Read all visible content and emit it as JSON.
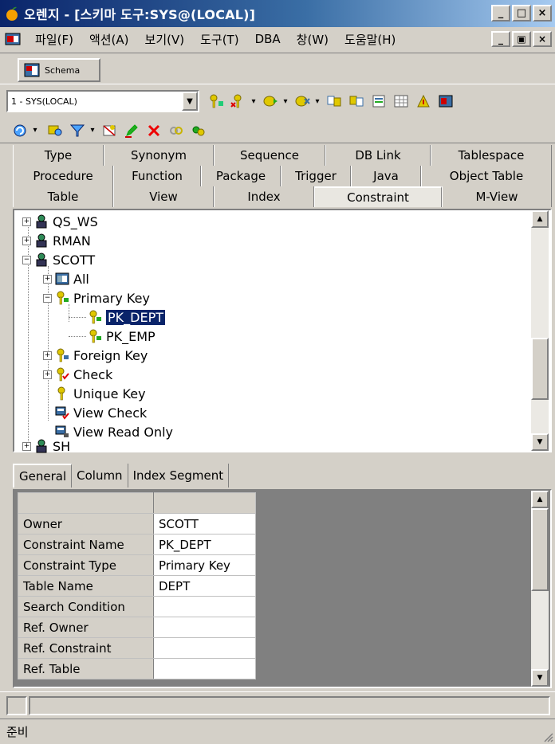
{
  "window": {
    "title": "오렌지 - [스키마 도구:SYS@(LOCAL)]"
  },
  "menu": [
    "파일(F)",
    "액션(A)",
    "보기(V)",
    "도구(T)",
    "DBA",
    "창(W)",
    "도움말(H)"
  ],
  "schema_tab": {
    "label": "Schema"
  },
  "toolbar": {
    "connection_value": "1 - SYS(LOCAL)"
  },
  "object_tabs": {
    "row1": [
      "Type",
      "Synonym",
      "Sequence",
      "DB Link",
      "Tablespace"
    ],
    "row2": [
      "Procedure",
      "Function",
      "Package",
      "Trigger",
      "Java",
      "Object Table"
    ],
    "row3": [
      "Table",
      "View",
      "Index",
      "Constraint",
      "M-View"
    ],
    "active": "Constraint"
  },
  "tree": {
    "users": [
      "QS_WS",
      "RMAN",
      "SCOTT",
      "SH"
    ],
    "scott_children": [
      "All",
      "Primary Key",
      "Foreign Key",
      "Check",
      "Unique Key",
      "View Check",
      "View Read Only"
    ],
    "primary_keys": [
      "PK_DEPT",
      "PK_EMP"
    ],
    "selected": "PK_DEPT"
  },
  "property_tabs": [
    "General",
    "Column",
    "Index Segment"
  ],
  "properties": [
    {
      "key": "Owner",
      "value": "SCOTT"
    },
    {
      "key": "Constraint Name",
      "value": "PK_DEPT"
    },
    {
      "key": "Constraint Type",
      "value": "Primary Key"
    },
    {
      "key": "Table Name",
      "value": "DEPT"
    },
    {
      "key": "Search Condition",
      "value": ""
    },
    {
      "key": "Ref. Owner",
      "value": ""
    },
    {
      "key": "Ref. Constraint",
      "value": ""
    },
    {
      "key": "Ref. Table",
      "value": ""
    }
  ],
  "status": {
    "text": "준비"
  },
  "colors": {
    "titlebar": "#0a246a",
    "selection": "#0a246a",
    "face": "#d4d0c8",
    "key_icon": "#c8b400"
  }
}
